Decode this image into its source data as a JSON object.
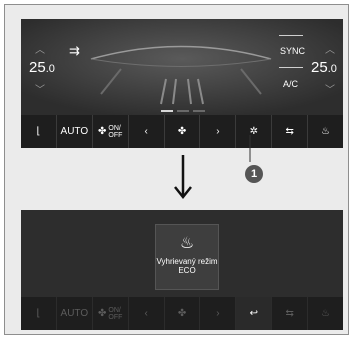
{
  "top_screen": {
    "temp_left": "25",
    "temp_left_decimal": ".0",
    "temp_right": "25",
    "temp_right_decimal": ".0",
    "sync_label": "SYNC",
    "ac_label": "A/C",
    "bar": {
      "auto_label": "AUTO",
      "onoff_top": "ON/",
      "onoff_bottom": "OFF"
    }
  },
  "callout": {
    "number": "1"
  },
  "bottom_screen": {
    "eco_line1": "Vyhrievaný režim",
    "eco_line2": "ECO",
    "bar": {
      "auto_label": "AUTO",
      "onoff_top": "ON/",
      "onoff_bottom": "OFF"
    }
  }
}
